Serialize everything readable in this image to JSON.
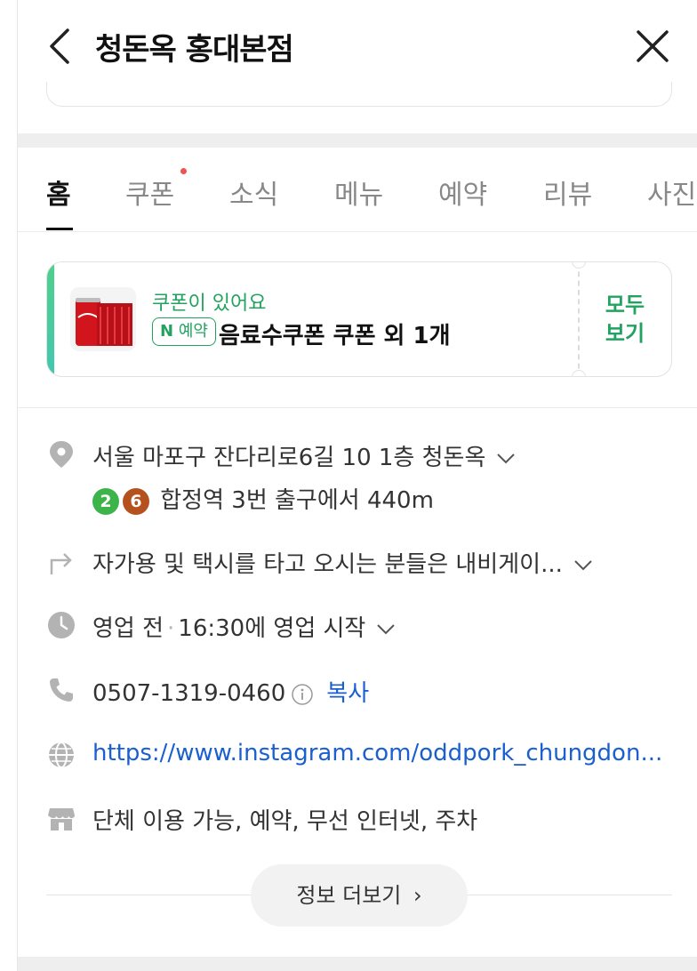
{
  "header": {
    "title": "청돈옥 홍대본점"
  },
  "tabs": [
    {
      "label": "홈",
      "active": true
    },
    {
      "label": "쿠폰",
      "has_dot": true
    },
    {
      "label": "소식"
    },
    {
      "label": "메뉴"
    },
    {
      "label": "예약"
    },
    {
      "label": "리뷰"
    },
    {
      "label": "사진"
    }
  ],
  "coupon": {
    "headline": "쿠폰이 있어요",
    "badge_n": "N",
    "badge_label": "예약",
    "text": "음료수쿠폰 쿠폰 외 1개",
    "all_label_line1": "모두",
    "all_label_line2": "보기",
    "accent_color": "#21a35f"
  },
  "info": {
    "address": "서울 마포구 잔다리로6길 10 1층 청돈옥",
    "subway_lines": [
      {
        "number": "2",
        "color": "#3cb44a"
      },
      {
        "number": "6",
        "color": "#b5501f"
      }
    ],
    "subway_text": "합정역 3번 출구에서 440m",
    "directions": "자가용 및 택시를 타고 오시는 분들은 내비게이...",
    "hours_status": "영업 전",
    "hours_sep": "·",
    "hours_detail": "16:30에 영업 시작",
    "phone": "0507-1319-0460",
    "copy_label": "복사",
    "website": "https://www.instagram.com/oddpork_chungdon...",
    "amenities": "단체 이용 가능, 예약, 무선 인터넷, 주차"
  },
  "more_button": {
    "label": "정보 더보기",
    "arrow": "›"
  },
  "icons": {
    "back": "back-arrow-icon",
    "close": "close-icon",
    "location": "location-pin-icon",
    "directions": "turn-arrow-icon",
    "clock": "clock-icon",
    "phone": "phone-icon",
    "globe": "globe-icon",
    "store": "store-icon"
  }
}
